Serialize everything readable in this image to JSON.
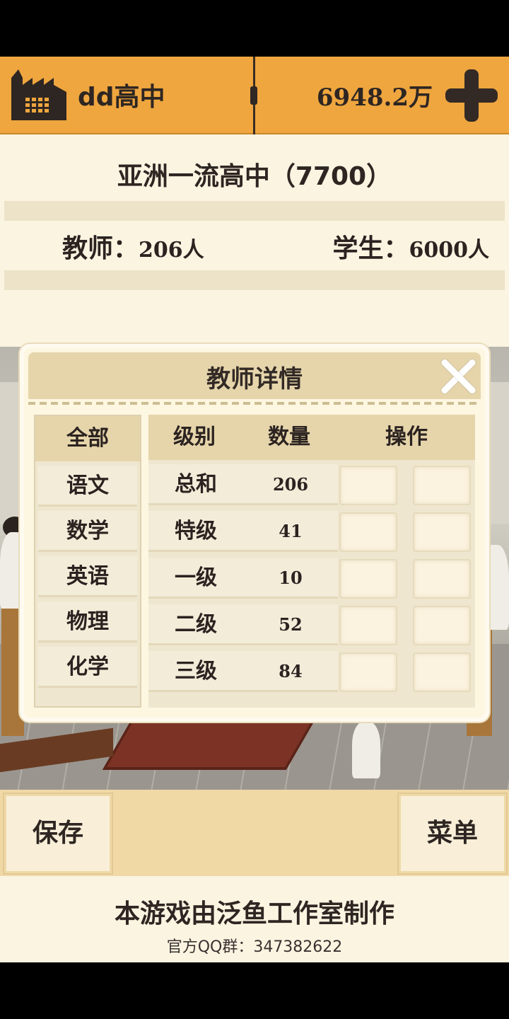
{
  "header": {
    "school_name": "dd高中",
    "money": "6948.2万",
    "icon": "factory-icon",
    "add_icon": "plus-icon"
  },
  "info": {
    "rank_title": "亚洲一流高中（7700）",
    "teachers_label": "教师：",
    "teachers_value": "206人",
    "students_label": "学生：",
    "students_value": "6000人"
  },
  "modal": {
    "title": "教师详情",
    "close_icon": "close-icon",
    "subjects": {
      "header": "全部",
      "items": [
        "语文",
        "数学",
        "英语",
        "物理",
        "化学"
      ]
    },
    "table": {
      "headers": [
        "级别",
        "数量",
        "操作"
      ],
      "rows": [
        {
          "level": "总和",
          "count": "206"
        },
        {
          "level": "特级",
          "count": "41"
        },
        {
          "level": "一级",
          "count": "10"
        },
        {
          "level": "二级",
          "count": "52"
        },
        {
          "level": "三级",
          "count": "84"
        }
      ]
    }
  },
  "bottom": {
    "save_label": "保存",
    "menu_label": "菜单"
  },
  "credits": {
    "studio": "本游戏由泛鱼工作室制作",
    "qq_group": "官方QQ群：347382622"
  },
  "colors": {
    "topbar": "#efa63f",
    "panel": "#fbf4e1",
    "header_band": "#e6d5ab",
    "text_dark": "#2e2622"
  }
}
